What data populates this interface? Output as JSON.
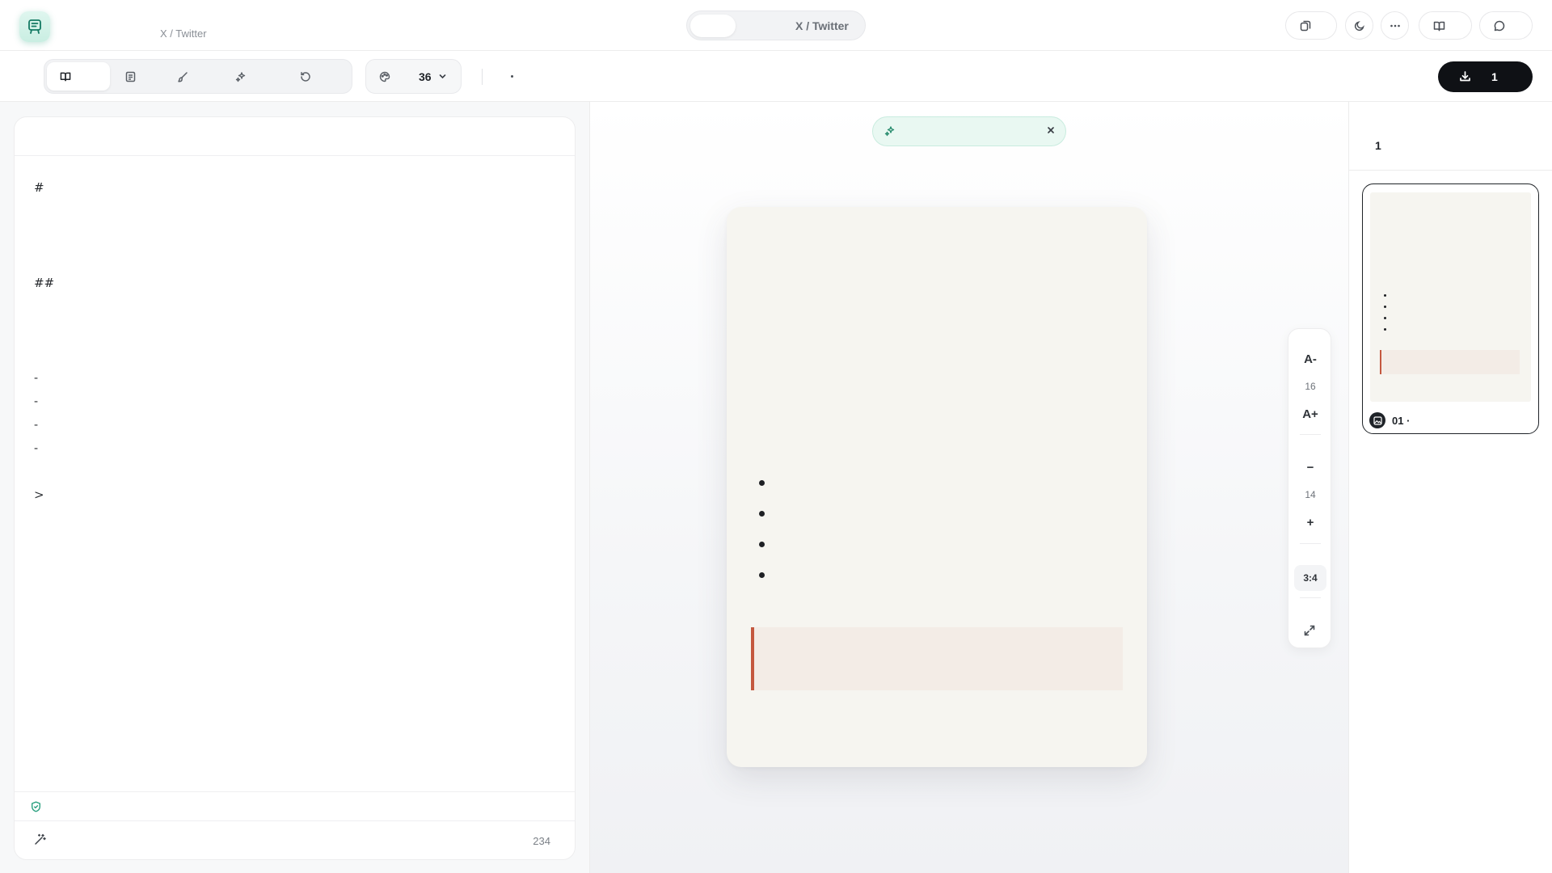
{
  "header": {
    "breadcrumb": "X / Twitter",
    "platform_label": "X / Twitter",
    "buttons": [
      {
        "name": "copy-format-icon"
      },
      {
        "name": "dark-mode-icon"
      },
      {
        "name": "more-options-icon"
      },
      {
        "name": "guide-book-icon"
      },
      {
        "name": "feedback-chat-icon"
      }
    ]
  },
  "toolbar": {
    "tabs": [
      {
        "icon": "book-icon",
        "active": true
      },
      {
        "icon": "template-icon",
        "active": false
      },
      {
        "icon": "brush-icon",
        "active": false
      },
      {
        "icon": "sparkle-icon",
        "active": false
      },
      {
        "icon": "history-icon",
        "active": false
      }
    ],
    "theme_count": "36",
    "theme_icon": "palette-icon",
    "separator_text": "·",
    "export_count": "1",
    "export_icon": "download-icon"
  },
  "editor": {
    "lines": [
      "#",
      "##",
      "-",
      "-",
      "-",
      "-",
      ">"
    ],
    "word_count": "234",
    "safety_icon": "shield-check-icon",
    "ai_icon": "magic-wand-icon"
  },
  "toast": {
    "icon": "sparkle-icon",
    "close_icon": "close-icon"
  },
  "preview": {
    "bullet_count": 4,
    "accent_color": "#c4583f",
    "card_color": "#f6f5f0"
  },
  "rail": {
    "font_decrease": "A-",
    "font_size": "16",
    "font_increase": "A+",
    "spacing_decrease": "−",
    "spacing_value": "14",
    "spacing_increase": "+",
    "ratio": "3:4",
    "expand_icon": "expand-icon"
  },
  "pages": {
    "count": "1",
    "items": [
      {
        "label": "01 ·",
        "icon": "image-icon"
      }
    ]
  }
}
